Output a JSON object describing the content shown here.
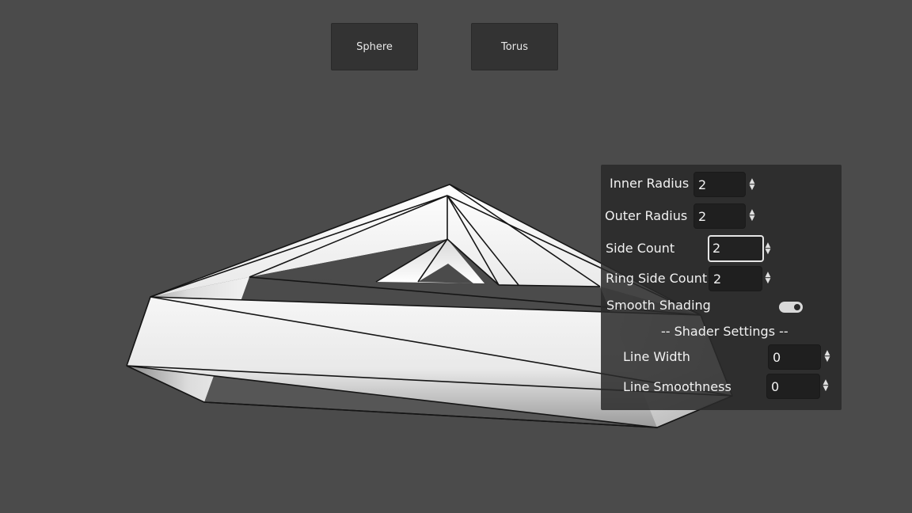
{
  "toolbar": {
    "sphere_label": "Sphere",
    "torus_label": "Torus"
  },
  "settings": {
    "inner_radius": {
      "label": "Inner Radius",
      "value": "2"
    },
    "outer_radius": {
      "label": "Outer Radius",
      "value": "2"
    },
    "side_count": {
      "label": "Side Count",
      "value": "2"
    },
    "ring_side_count": {
      "label": "Ring Side Count",
      "value": "2"
    },
    "smooth_shading": {
      "label": "Smooth Shading",
      "enabled": true
    },
    "shader_heading": "-- Shader Settings --",
    "line_width": {
      "label": "Line Width",
      "value": "0"
    },
    "line_smoothness": {
      "label": "Line Smoothness",
      "value": "0"
    }
  },
  "colors": {
    "background": "#4b4b4b",
    "panel": "#2a2a2a",
    "button": "#333333",
    "mesh_highlight": "#ffffff",
    "wireframe": "#111111"
  }
}
